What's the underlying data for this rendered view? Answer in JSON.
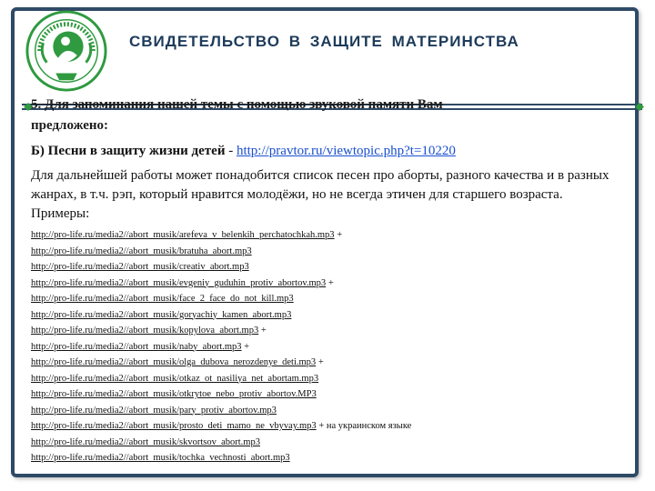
{
  "header": {
    "title": "СВИДЕТЕЛЬСТВО  В  ЗАЩИТЕ  МАТЕРИНСТВА",
    "logo_icon": "green-emblem-mother-child",
    "accent_color": "#2e4a66",
    "logo_green": "#2f9a3f"
  },
  "content": {
    "intro_line1": "5. Для запоминания нашей темы с помощью звуковой памяти Вам",
    "intro_line2": "предложено:",
    "b_label": "Б) Песни в защиту жизни детей",
    "b_dash": " - ",
    "b_link": "http://pravtor.ru/viewtopic.php?t=10220",
    "paragraph": "Для дальнейшей работы может понадобится список песен про аборты, разного качества и в разных жанрах, в т.ч. рэп, который нравится молодёжи, но не всегда этичен для старшего возраста. Примеры:"
  },
  "links": [
    {
      "url": "http://pro-life.ru/media2//abort_musik/arefeva_v_belenkih_perchatochkah.mp3",
      "suffix": " +"
    },
    {
      "url": "http://pro-life.ru/media2//abort_musik/bratuha_abort.mp3",
      "suffix": ""
    },
    {
      "url": "http://pro-life.ru/media2//abort_musik/creativ_abort.mp3",
      "suffix": ""
    },
    {
      "url": "http://pro-life.ru/media2//abort_musik/evgeniy_guduhin_protiv_abortov.mp3",
      "suffix": " +"
    },
    {
      "url": "http://pro-life.ru/media2//abort_musik/face_2_face_do_not_kill.mp3",
      "suffix": ""
    },
    {
      "url": "http://pro-life.ru/media2//abort_musik/goryachiy_kamen_abort.mp3",
      "suffix": ""
    },
    {
      "url": "http://pro-life.ru/media2//abort_musik/kopylova_abort.mp3",
      "suffix": " +"
    },
    {
      "url": "http://pro-life.ru/media2//abort_musik/naby_abort.mp3",
      "suffix": " +"
    },
    {
      "url": "http://pro-life.ru/media2//abort_musik/olga_dubova_nerozdenye_deti.mp3",
      "suffix": " +"
    },
    {
      "url": "http://pro-life.ru/media2//abort_musik/otkaz_ot_nasiliya_net_abortam.mp3",
      "suffix": ""
    },
    {
      "url": "http://pro-life.ru/media2//abort_musik/otkrytoe_nebo_protiv_abortov.MP3",
      "suffix": ""
    },
    {
      "url": "http://pro-life.ru/media2//abort_musik/pary_protiv_abortov.mp3",
      "suffix": ""
    },
    {
      "url": "http://pro-life.ru/media2//abort_musik/prosto_deti_mamo_ne_vbyvay.mp3",
      "suffix": " + на украинском языке"
    },
    {
      "url": "http://pro-life.ru/media2//abort_musik/skvortsov_abort.mp3",
      "suffix": ""
    },
    {
      "url": "http://pro-life.ru/media2//abort_musik/tochka_vechnosti_abort.mp3",
      "suffix": ""
    }
  ]
}
